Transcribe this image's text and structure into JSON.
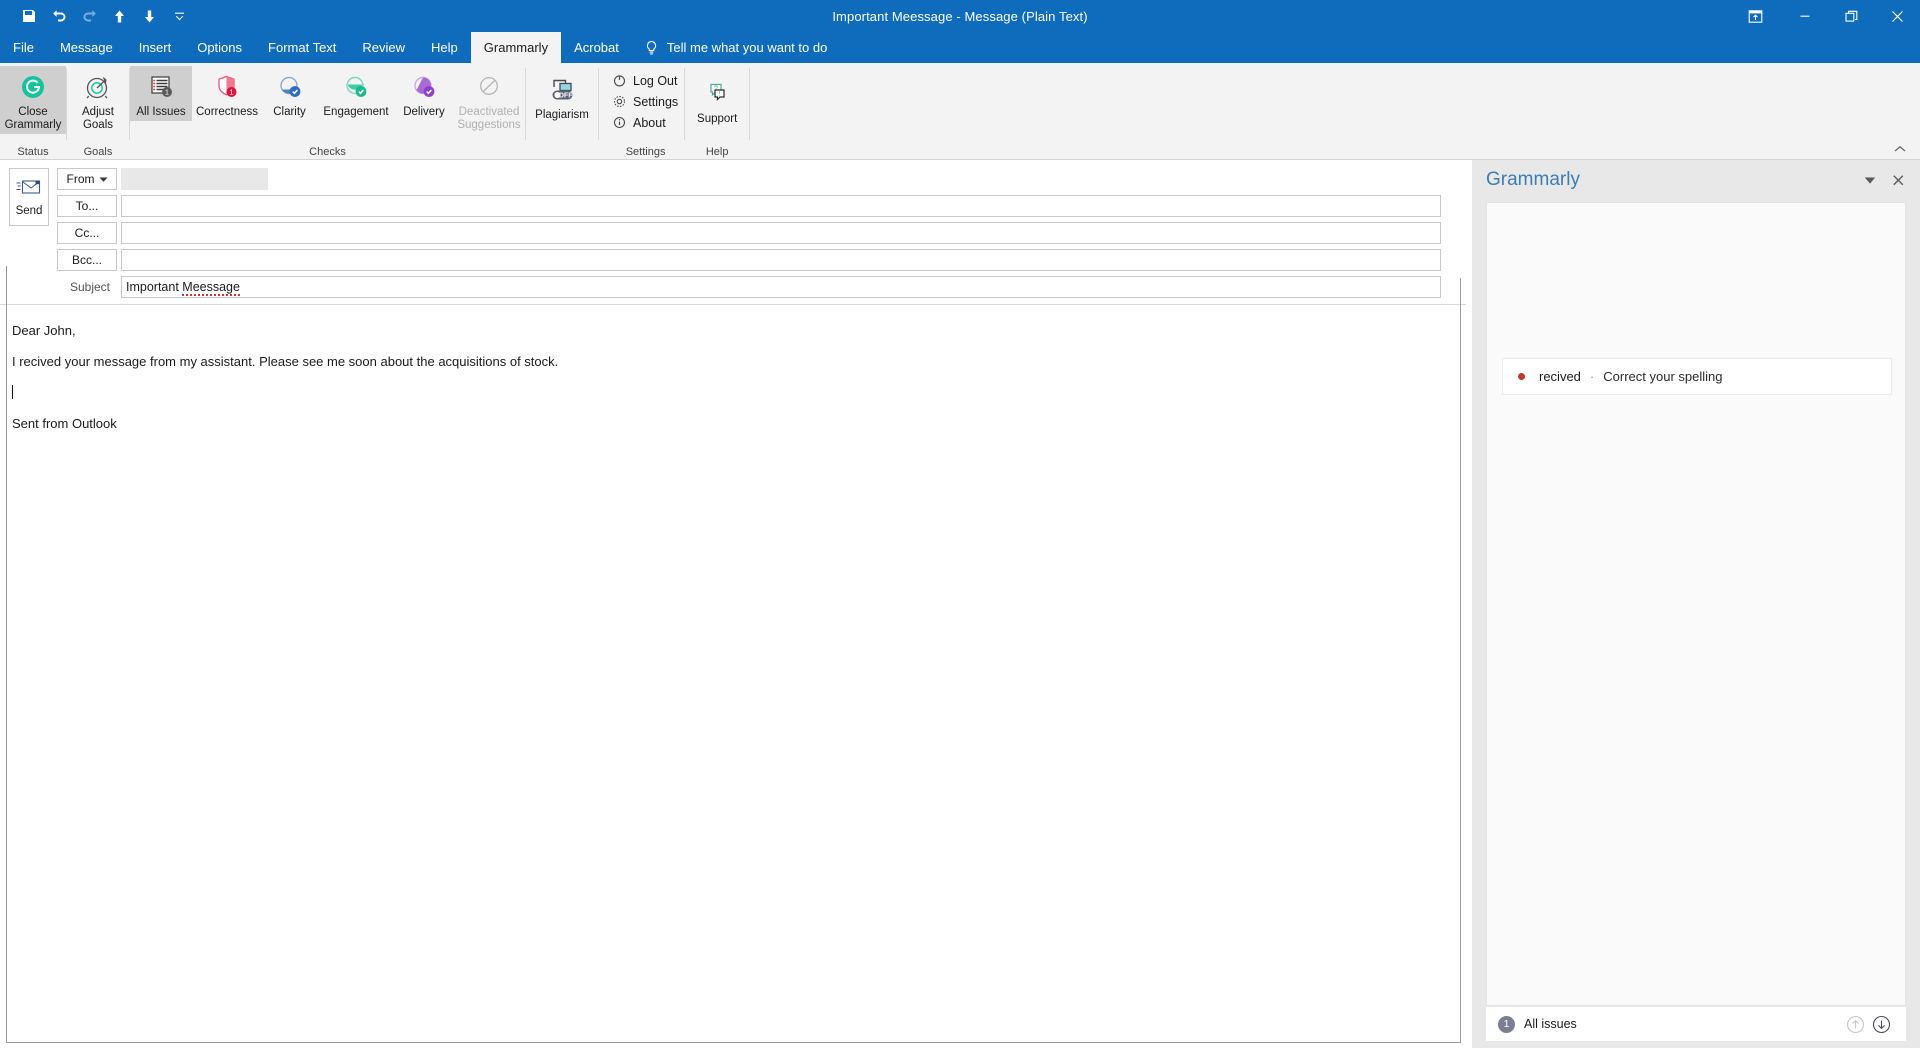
{
  "window": {
    "title": "Important Meessage  -  Message (Plain Text)",
    "quick_access": [
      {
        "name": "save-icon",
        "label": "Save"
      },
      {
        "name": "undo-icon",
        "label": "Undo"
      },
      {
        "name": "redo-icon",
        "label": "Redo"
      },
      {
        "name": "previous-item-icon",
        "label": "Previous Item"
      },
      {
        "name": "next-item-icon",
        "label": "Next Item"
      },
      {
        "name": "customize-quick-access-toolbar-icon",
        "label": "Customize Quick Access Toolbar"
      }
    ],
    "controls": [
      {
        "name": "ribbon-display-options-icon",
        "label": "Ribbon Display Options"
      },
      {
        "name": "minimize-icon",
        "label": "Minimize"
      },
      {
        "name": "restore-icon",
        "label": "Restore Down"
      },
      {
        "name": "close-icon",
        "label": "Close"
      }
    ]
  },
  "tabs": [
    {
      "label": "File",
      "active": false
    },
    {
      "label": "Message",
      "active": false
    },
    {
      "label": "Insert",
      "active": false
    },
    {
      "label": "Options",
      "active": false
    },
    {
      "label": "Format Text",
      "active": false
    },
    {
      "label": "Review",
      "active": false
    },
    {
      "label": "Help",
      "active": false
    },
    {
      "label": "Grammarly",
      "active": true
    },
    {
      "label": "Acrobat",
      "active": false
    }
  ],
  "tell_me": {
    "label": "Tell me what you want to do",
    "icon": "lightbulb-icon"
  },
  "ribbon": {
    "groups": [
      {
        "name": "status",
        "label": "Status",
        "buttons": [
          {
            "name": "close-grammarly",
            "label": "Close\nGrammarly",
            "icon": "grammarly-logo-icon",
            "selected": true,
            "disabled": false
          }
        ]
      },
      {
        "name": "goals",
        "label": "Goals",
        "buttons": [
          {
            "name": "adjust-goals",
            "label": "Adjust\nGoals",
            "icon": "target-goal-icon",
            "selected": false,
            "disabled": false
          }
        ]
      },
      {
        "name": "checks",
        "label": "Checks",
        "buttons": [
          {
            "name": "all-issues",
            "label": "All Issues",
            "icon": "all-issues-list-icon",
            "selected": true,
            "disabled": false,
            "count": "1"
          },
          {
            "name": "correctness",
            "label": "Correctness",
            "icon": "correctness-shield-icon",
            "selected": false,
            "disabled": false,
            "count": "1"
          },
          {
            "name": "clarity",
            "label": "Clarity",
            "icon": "clarity-check-icon",
            "selected": false,
            "disabled": false
          },
          {
            "name": "engagement",
            "label": "Engagement",
            "icon": "engagement-check-icon",
            "selected": false,
            "disabled": false
          },
          {
            "name": "delivery",
            "label": "Delivery",
            "icon": "delivery-check-icon",
            "selected": false,
            "disabled": false
          },
          {
            "name": "deactivated-suggestions",
            "label": "Deactivated\nSuggestions",
            "icon": "deactivated-circle-slash-icon",
            "selected": false,
            "disabled": true
          }
        ]
      },
      {
        "name": "plagiarism",
        "label": "",
        "buttons": [
          {
            "name": "plagiarism",
            "label": "Plagiarism",
            "icon": "plagiarism-toggle-off-icon",
            "selected": false,
            "disabled": false,
            "toggle": "OFF"
          }
        ]
      },
      {
        "name": "settings",
        "label": "Settings",
        "menu": [
          {
            "name": "log-out",
            "label": "Log Out",
            "icon": "power-icon"
          },
          {
            "name": "settings",
            "label": "Settings",
            "icon": "gear-icon"
          },
          {
            "name": "about",
            "label": "About",
            "icon": "info-icon"
          }
        ]
      },
      {
        "name": "help",
        "label": "Help",
        "buttons": [
          {
            "name": "support",
            "label": "Support",
            "icon": "support-chat-icon",
            "selected": false,
            "disabled": false
          }
        ]
      }
    ],
    "collapse_icon": "collapse-ribbon-icon"
  },
  "compose": {
    "send_button": {
      "label": "Send",
      "icon": "send-envelope-icon"
    },
    "fields": [
      {
        "name": "from",
        "type": "button",
        "label": "From",
        "value": "",
        "has_caret": true,
        "blank_chip": true
      },
      {
        "name": "to",
        "type": "button",
        "label": "To...",
        "value": ""
      },
      {
        "name": "cc",
        "type": "button",
        "label": "Cc...",
        "value": ""
      },
      {
        "name": "bcc",
        "type": "button",
        "label": "Bcc...",
        "value": ""
      },
      {
        "name": "subject",
        "type": "label",
        "label": "Subject",
        "value": "Important Meessage",
        "misspelled": "Meessage"
      }
    ],
    "body": {
      "greeting": "Dear John,",
      "paragraph": "I recived your message from my assistant. Please see me soon about the acquisitions of stock.",
      "signature": "Sent from Outlook"
    }
  },
  "grammarly_panel": {
    "title": "Grammarly",
    "dropdown_icon": "chevron-down-icon",
    "close_icon": "close-icon",
    "suggestions": [
      {
        "word": "recived",
        "separator": "·",
        "description": "Correct your spelling",
        "severity_color": "#C0392B"
      }
    ],
    "footer": {
      "count": "1",
      "label": "All issues",
      "prev_icon": "arrow-up-circle-icon",
      "next_icon": "arrow-down-circle-icon"
    }
  },
  "colors": {
    "titlebar": "#0F6CBD",
    "ribbon_bg": "#F3F3F3",
    "panel_bg": "#E8E8E8",
    "grammarly_green": "#15C39A",
    "error_red": "#C0392B",
    "panel_title": "#3C7DB0"
  }
}
